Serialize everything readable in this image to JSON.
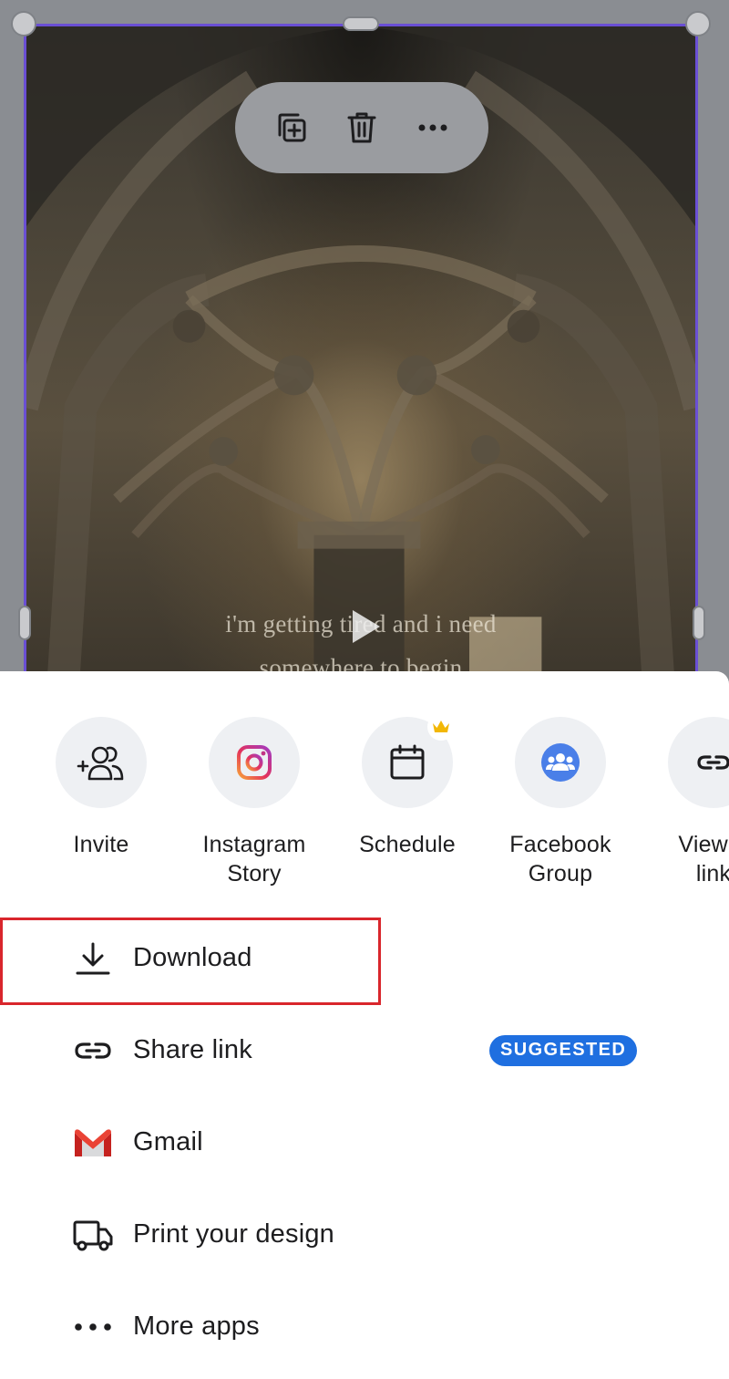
{
  "design": {
    "caption_line1": "i'm getting tired and i need",
    "caption_line2": "somewhere to begin"
  },
  "toolbar": {
    "duplicate_icon": "duplicate-icon",
    "delete_icon": "trash-icon",
    "more_icon": "more-horizontal-icon"
  },
  "share_targets": [
    {
      "label_line1": "Invite",
      "label_line2": "",
      "icon": "invite-people-icon"
    },
    {
      "label_line1": "Instagram",
      "label_line2": "Story",
      "icon": "instagram-icon"
    },
    {
      "label_line1": "Schedule",
      "label_line2": "",
      "icon": "calendar-icon",
      "premium": true
    },
    {
      "label_line1": "Facebook",
      "label_line2": "Group",
      "icon": "facebook-group-icon"
    },
    {
      "label_line1": "View-o",
      "label_line2": "link",
      "icon": "link-icon"
    }
  ],
  "actions": [
    {
      "label": "Download",
      "icon": "download-icon"
    },
    {
      "label": "Share link",
      "icon": "link-icon",
      "badge": "SUGGESTED"
    },
    {
      "label": "Gmail",
      "icon": "gmail-icon"
    },
    {
      "label": "Print your design",
      "icon": "truck-icon"
    },
    {
      "label": "More apps",
      "icon": "more-horizontal-icon"
    }
  ],
  "colors": {
    "selection": "#6a4fd4",
    "badge": "#1f6fe0",
    "highlight": "#d9262c",
    "facebook": "#4a7fe8",
    "crown": "#f2b705"
  }
}
